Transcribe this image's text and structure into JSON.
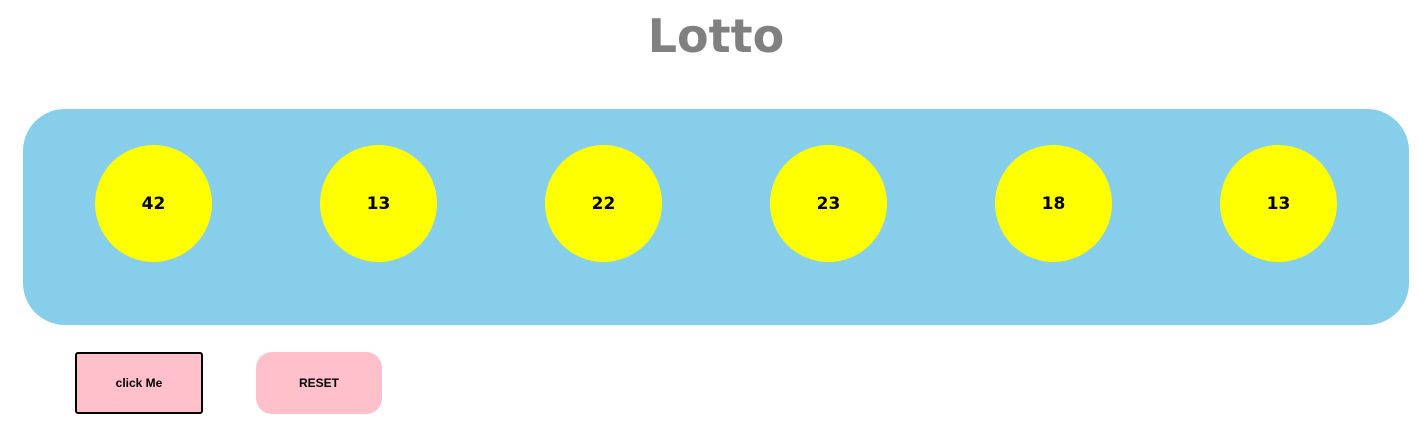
{
  "header": {
    "title": "Lotto"
  },
  "balls": [
    {
      "number": "42"
    },
    {
      "number": "13"
    },
    {
      "number": "22"
    },
    {
      "number": "23"
    },
    {
      "number": "18"
    },
    {
      "number": "13"
    }
  ],
  "actions": {
    "click_label": "click Me",
    "reset_label": "RESET"
  },
  "colors": {
    "title": "#808080",
    "panel": "#87ceeb",
    "ball": "#ffff00",
    "button": "#ffc0cb"
  }
}
